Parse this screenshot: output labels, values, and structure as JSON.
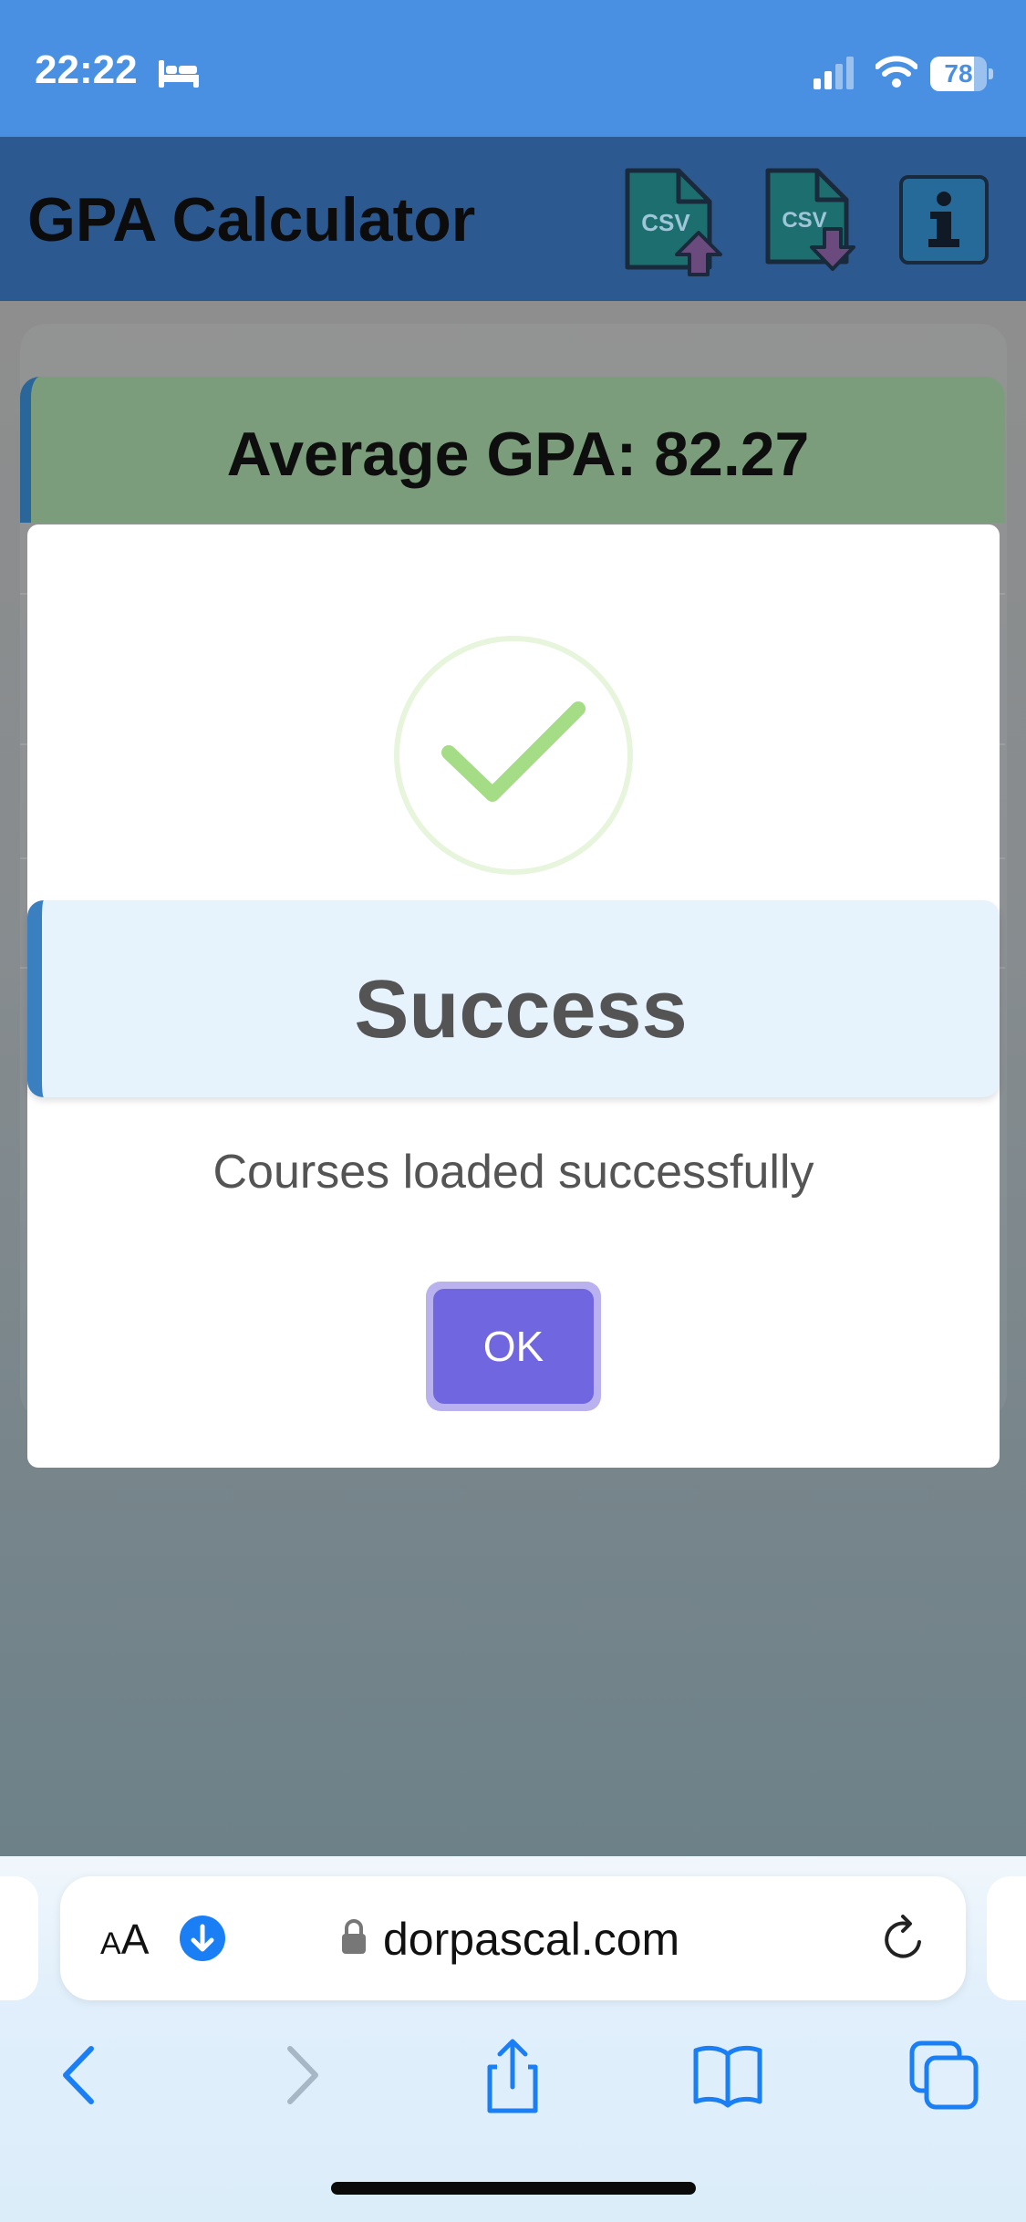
{
  "status_bar": {
    "time": "22:22",
    "battery_level": "78",
    "icons": [
      "bed-icon",
      "signal-icon",
      "wifi-icon",
      "battery-icon"
    ]
  },
  "header": {
    "title": "GPA Calculator",
    "csv_upload_label": "CSV",
    "csv_download_label": "CSV",
    "info_label": "i"
  },
  "main": {
    "average_gpa_text": "Average GPA: 82.27"
  },
  "modal": {
    "title": "Success",
    "message": "Courses loaded successfully",
    "ok_label": "OK",
    "icon": "success-check-icon"
  },
  "browser": {
    "text_size_label_small": "A",
    "text_size_label_large": "A",
    "url": "dorpascal.com",
    "nav": [
      "back-icon",
      "forward-icon",
      "share-icon",
      "bookmarks-icon",
      "tabs-icon"
    ]
  },
  "colors": {
    "status_bar": "#4a90e2",
    "header": "#2c5990",
    "gpa_banner": "#7c9d7c",
    "success_band": "#e6f2fc",
    "success_accent": "#3a7fc0",
    "ok_button": "#7066e0",
    "check": "#a5dc86"
  }
}
